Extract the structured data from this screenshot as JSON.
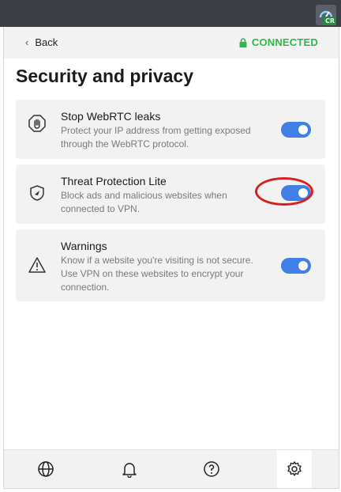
{
  "extension": {
    "badge": "CR",
    "icon": "gauge-icon"
  },
  "header": {
    "back_label": "Back",
    "status": "CONNECTED",
    "status_color": "#2fb84a",
    "status_icon": "lock-icon"
  },
  "page": {
    "title": "Security and privacy"
  },
  "settings": [
    {
      "label": "Stop WebRTC leaks",
      "description": "Protect your IP address from getting exposed through the WebRTC protocol.",
      "enabled": true,
      "icon": "hand-stop-icon"
    },
    {
      "label": "Threat Protection Lite",
      "description": "Block ads and malicious websites when connected to VPN.",
      "enabled": true,
      "icon": "shield-icon"
    },
    {
      "label": "Warnings",
      "description": "Know if a website you're visiting is not secure. Use VPN on these websites to encrypt your connection.",
      "enabled": true,
      "icon": "warning-icon"
    }
  ],
  "bottom_nav": [
    {
      "icon": "globe-icon",
      "active": false
    },
    {
      "icon": "bell-icon",
      "active": false
    },
    {
      "icon": "help-icon",
      "active": false
    },
    {
      "icon": "gear-icon",
      "active": true
    }
  ],
  "colors": {
    "toggle_on": "#3f7fe6",
    "highlight": "#d71f1f"
  }
}
